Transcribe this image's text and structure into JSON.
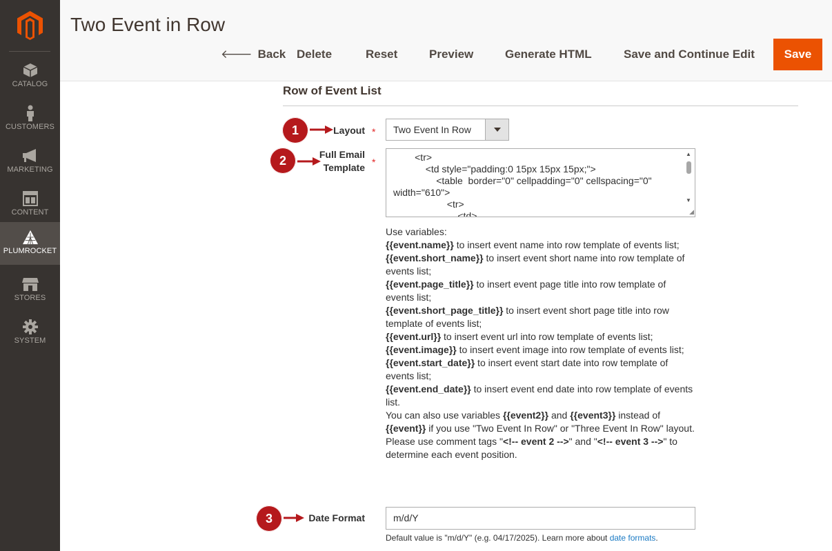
{
  "sidebar": {
    "items": [
      {
        "label": "CATALOG",
        "icon": "cube-icon"
      },
      {
        "label": "CUSTOMERS",
        "icon": "person-icon"
      },
      {
        "label": "MARKETING",
        "icon": "megaphone-icon"
      },
      {
        "label": "CONTENT",
        "icon": "layout-icon"
      },
      {
        "label": "PLUMROCKET",
        "icon": "plumrocket-icon"
      },
      {
        "label": "STORES",
        "icon": "store-icon"
      },
      {
        "label": "SYSTEM",
        "icon": "gear-icon"
      }
    ],
    "active": "PLUMROCKET"
  },
  "header": {
    "title": "Two Event in Row",
    "actions": {
      "back": "Back",
      "delete": "Delete",
      "reset": "Reset",
      "preview": "Preview",
      "generate_html": "Generate HTML",
      "save_continue": "Save and Continue Edit",
      "save": "Save"
    }
  },
  "section": {
    "title": "Row of Event List"
  },
  "fields": {
    "layout": {
      "label": "Layout",
      "value": "Two Event In Row",
      "callout": "1"
    },
    "template": {
      "label_line1": "Full Email",
      "label_line2": "Template",
      "value": "        <tr>\n            <td style=\"padding:0 15px 15px 15px;\">\n                <table  border=\"0\" cellpadding=\"0\" cellspacing=\"0\" width=\"610\">\n                    <tr>\n                        <td>",
      "callout": "2"
    },
    "date_format": {
      "label": "Date Format",
      "value": "m/d/Y",
      "callout": "3",
      "note_prefix": "Default value is \"m/d/Y\" (e.g. 04/17/2025). Learn more about ",
      "note_link": "date formats",
      "note_suffix": "."
    }
  },
  "help": {
    "intro": "Use variables:",
    "vars": [
      {
        "name": "{{event.name}}",
        "text": " to insert event name into row template of events list;"
      },
      {
        "name": "{{event.short_name}}",
        "text": " to insert event short name into row template of events list;"
      },
      {
        "name": "{{event.page_title}}",
        "text": " to insert event page title into row template of events list;"
      },
      {
        "name": "{{event.short_page_title}}",
        "text": " to insert event short page title into row template of events list;"
      },
      {
        "name": "{{event.url}}",
        "text": " to insert event url into row template of events list;"
      },
      {
        "name": "{{event.image}}",
        "text": " to insert event image into row template of events list;"
      },
      {
        "name": "{{event.start_date}}",
        "text": " to insert event start date into row template of events list;"
      },
      {
        "name": "{{event.end_date}}",
        "text": " to insert event end date into row template of events list."
      }
    ],
    "also_1": "You can also use variables ",
    "also_v1": "{{event2}}",
    "also_2": " and ",
    "also_v2": "{{event3}}",
    "also_3": " instead of ",
    "also_v3": "{{event}}",
    "also_4": " if you use \"Two Event In Row\" or \"Three Event In Row\" layout.",
    "comment_1": "Please use comment tags \"",
    "comment_v1": "<!-- event 2 -->",
    "comment_2": "\" and \"",
    "comment_v2": "<!-- event 3 -->",
    "comment_3": "\" to determine each event position."
  },
  "colors": {
    "sidebar": "#373330",
    "accent": "#eb5202",
    "callout": "#b5191c",
    "link": "#1979c3"
  }
}
